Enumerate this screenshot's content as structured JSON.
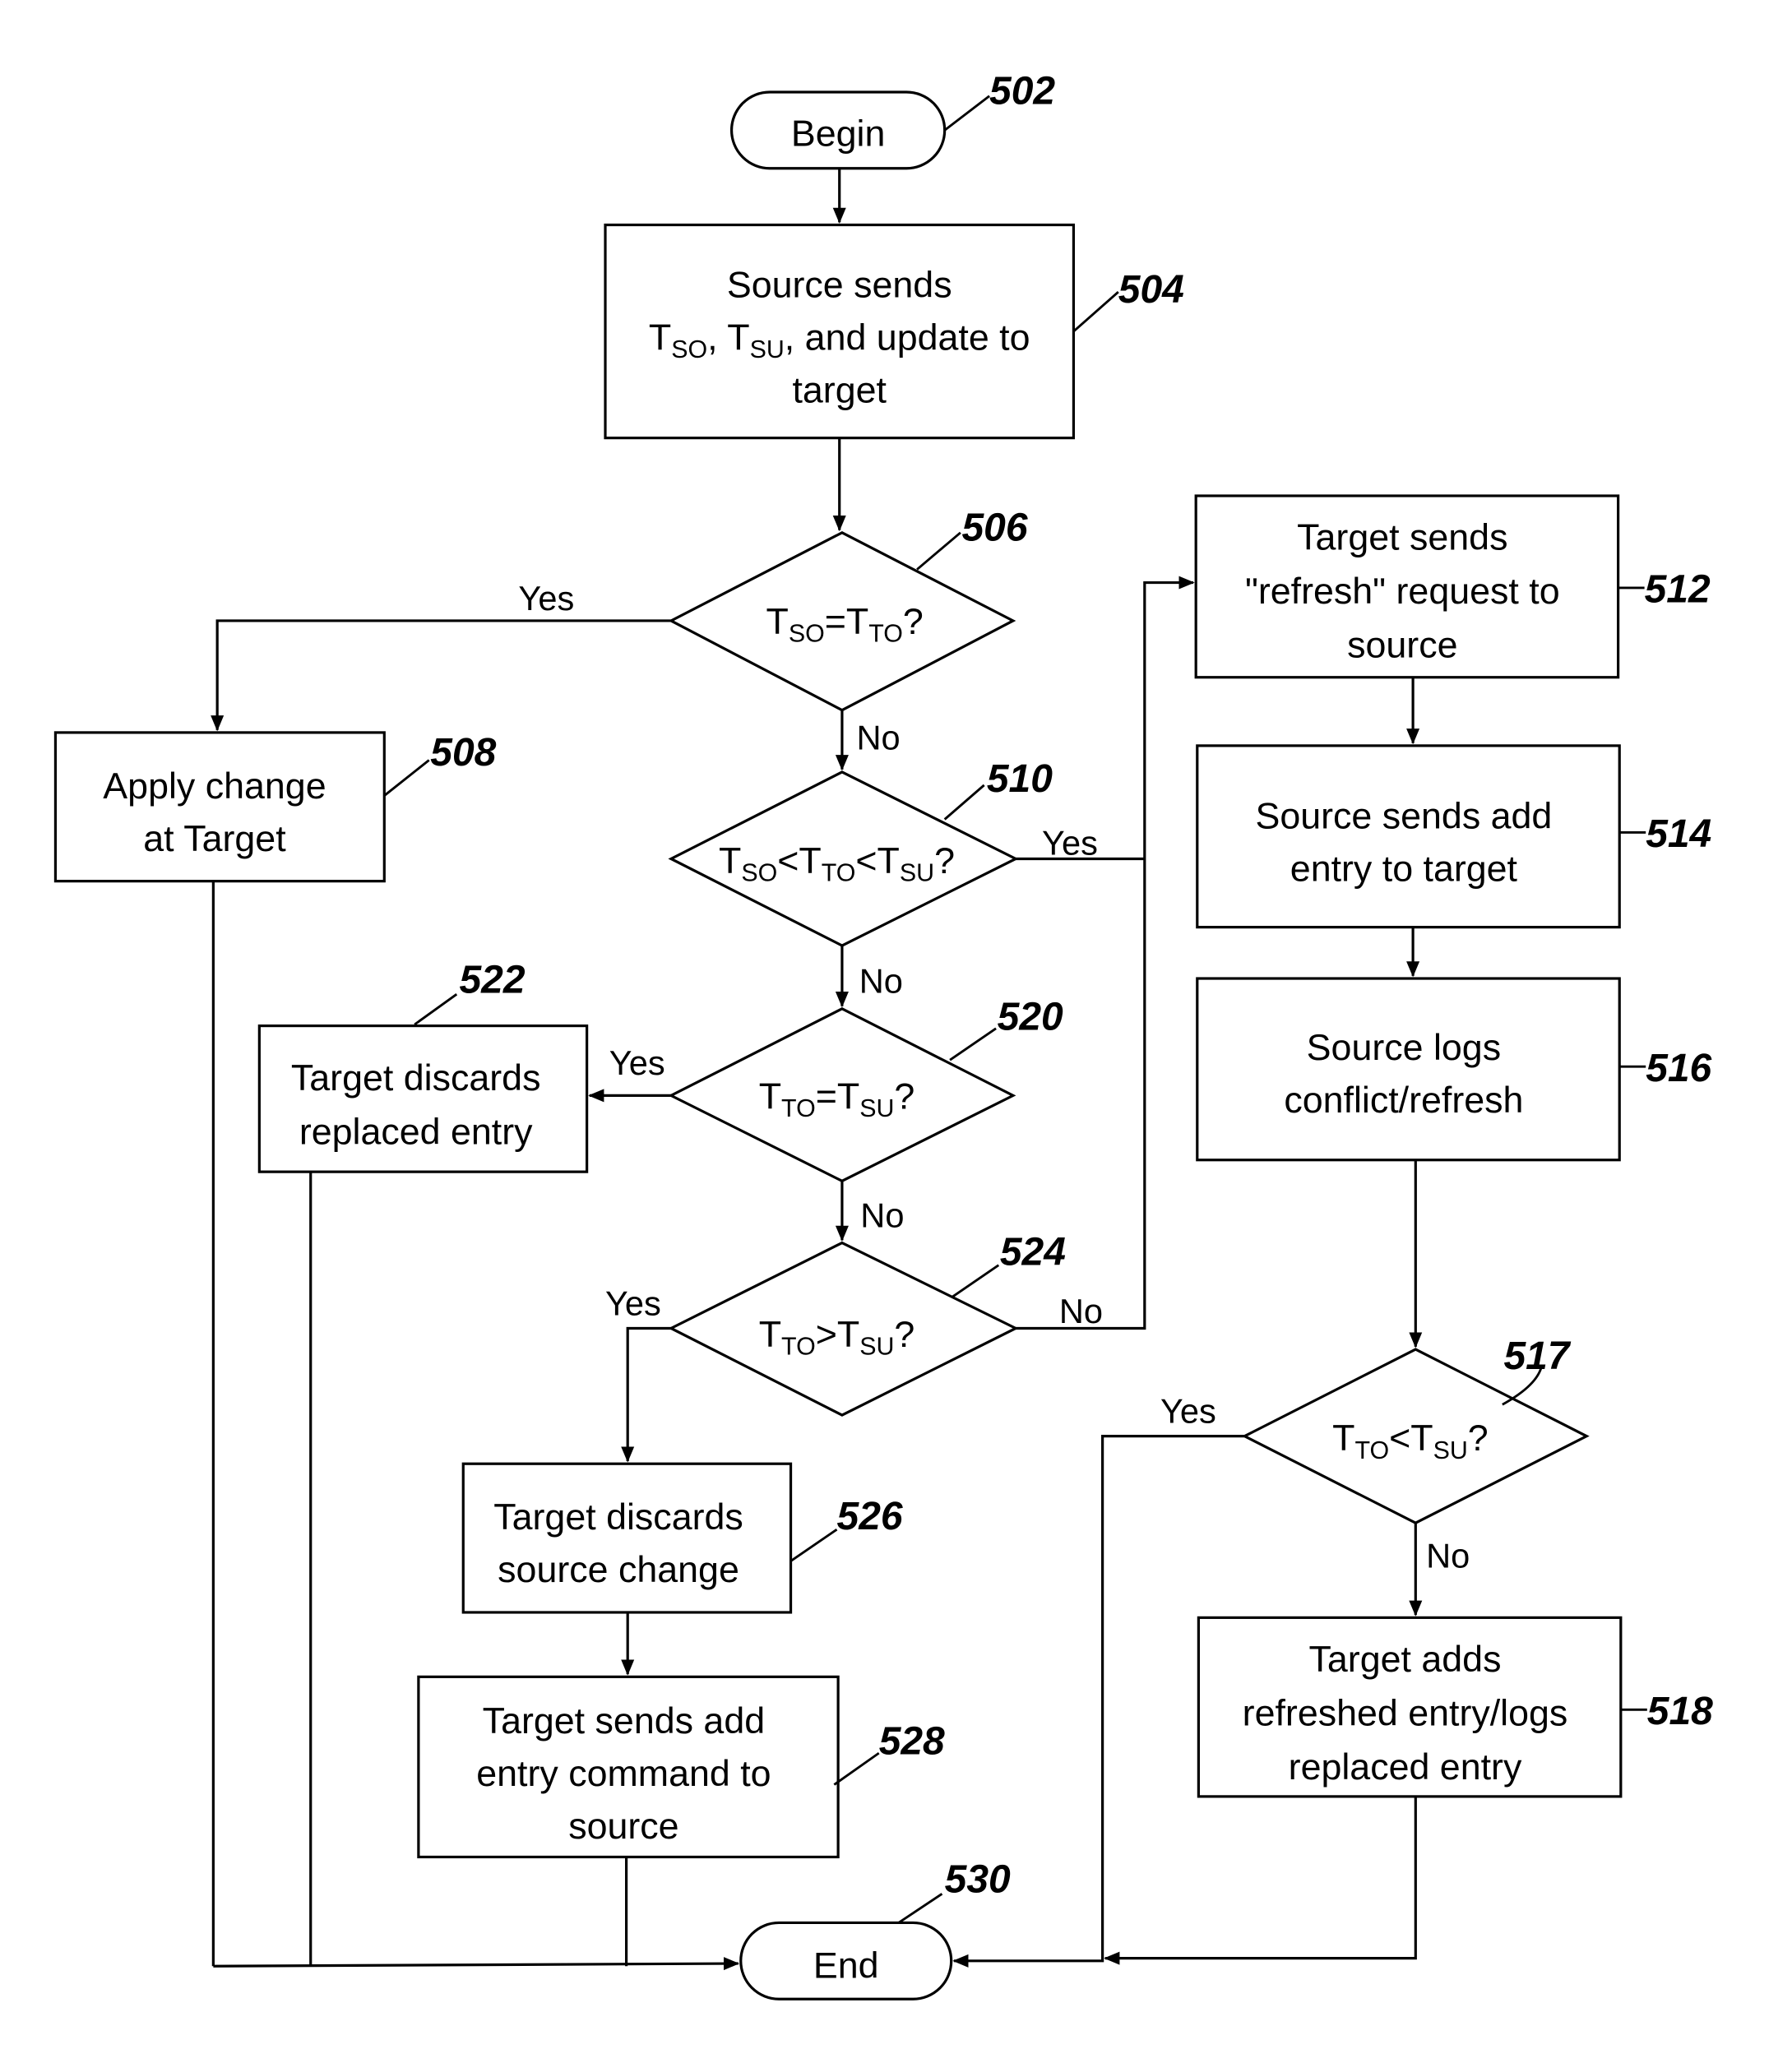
{
  "nodes": {
    "n502": {
      "ref": "502",
      "type": "terminator",
      "lines": [
        "Begin"
      ]
    },
    "n504": {
      "ref": "504",
      "type": "process",
      "lines": [
        "Source sends",
        "T|SO|, T|SU|, and update to",
        "target"
      ]
    },
    "n506": {
      "ref": "506",
      "type": "decision",
      "lines": [
        "T|SO|=T|TO|?"
      ]
    },
    "n508": {
      "ref": "508",
      "type": "process",
      "lines": [
        "Apply change",
        "at Target"
      ]
    },
    "n510": {
      "ref": "510",
      "type": "decision",
      "lines": [
        "T|SO|<T|TO|<T|SU|?"
      ]
    },
    "n512": {
      "ref": "512",
      "type": "process",
      "lines": [
        "Target sends",
        "\"refresh\" request to",
        "source"
      ]
    },
    "n514": {
      "ref": "514",
      "type": "process",
      "lines": [
        "Source sends add",
        "entry to target"
      ]
    },
    "n516": {
      "ref": "516",
      "type": "process",
      "lines": [
        "Source logs",
        "conflict/refresh"
      ]
    },
    "n517": {
      "ref": "517",
      "type": "decision",
      "lines": [
        "T|TO|<T|SU|?"
      ]
    },
    "n518": {
      "ref": "518",
      "type": "process",
      "lines": [
        "Target adds",
        "refreshed entry/logs",
        "replaced entry"
      ]
    },
    "n520": {
      "ref": "520",
      "type": "decision",
      "lines": [
        "T|TO|=T|SU|?"
      ]
    },
    "n522": {
      "ref": "522",
      "type": "process",
      "lines": [
        "Target discards",
        "replaced entry"
      ]
    },
    "n524": {
      "ref": "524",
      "type": "decision",
      "lines": [
        "T|TO|>T|SU|?"
      ]
    },
    "n526": {
      "ref": "526",
      "type": "process",
      "lines": [
        "Target discards",
        "source change"
      ]
    },
    "n528": {
      "ref": "528",
      "type": "process",
      "lines": [
        "Target sends add",
        "entry command to",
        "source"
      ]
    },
    "n530": {
      "ref": "530",
      "type": "terminator",
      "lines": [
        "End"
      ]
    }
  },
  "edge_labels": {
    "e506_yes": "Yes",
    "e506_no": "No",
    "e510_yes": "Yes",
    "e510_no": "No",
    "e520_yes": "Yes",
    "e520_no": "No",
    "e524_yes": "Yes",
    "e524_no": "No",
    "e517_yes": "Yes",
    "e517_no": "No"
  },
  "edges": [
    {
      "from": "502",
      "to": "504"
    },
    {
      "from": "504",
      "to": "506"
    },
    {
      "from": "506",
      "to": "508",
      "label": "Yes"
    },
    {
      "from": "506",
      "to": "510",
      "label": "No"
    },
    {
      "from": "510",
      "to": "512",
      "label": "Yes"
    },
    {
      "from": "510",
      "to": "520",
      "label": "No"
    },
    {
      "from": "520",
      "to": "522",
      "label": "Yes"
    },
    {
      "from": "520",
      "to": "524",
      "label": "No"
    },
    {
      "from": "524",
      "to": "526",
      "label": "Yes"
    },
    {
      "from": "524",
      "to": "512",
      "label": "No"
    },
    {
      "from": "512",
      "to": "514"
    },
    {
      "from": "514",
      "to": "516"
    },
    {
      "from": "516",
      "to": "517"
    },
    {
      "from": "517",
      "to": "530",
      "label": "Yes"
    },
    {
      "from": "517",
      "to": "518",
      "label": "No"
    },
    {
      "from": "518",
      "to": "530"
    },
    {
      "from": "526",
      "to": "528"
    },
    {
      "from": "528",
      "to": "530"
    },
    {
      "from": "508",
      "to": "530"
    },
    {
      "from": "522",
      "to": "530"
    }
  ]
}
